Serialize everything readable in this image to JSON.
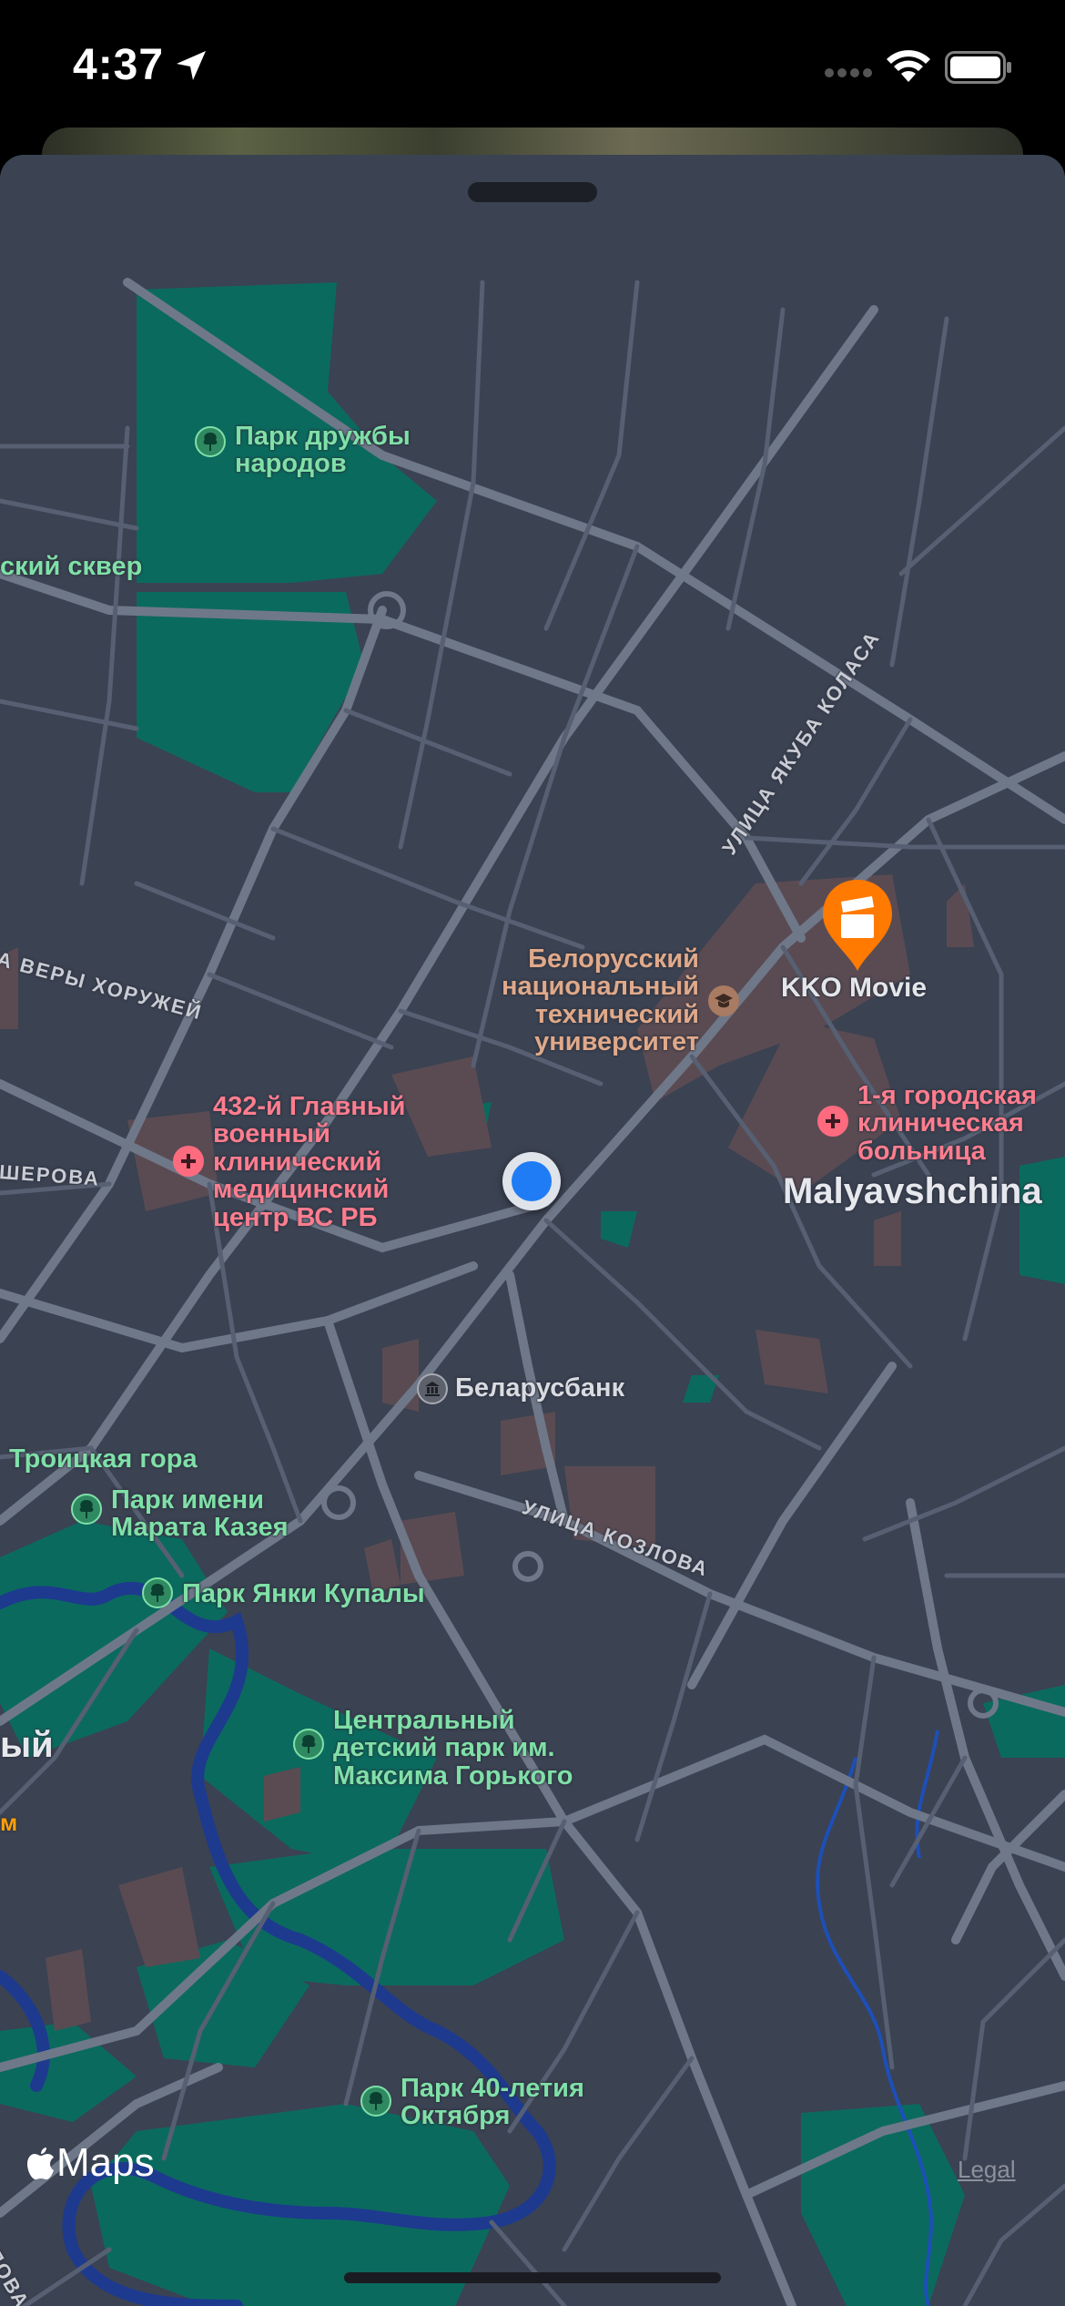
{
  "status_bar": {
    "time": "4:37",
    "icons": [
      "location-arrow-icon",
      "cellular-signal-icon",
      "wifi-icon",
      "battery-icon"
    ]
  },
  "map": {
    "colors": {
      "background": "#3b4252",
      "road": "#6f7889",
      "park": "#0b6a5e",
      "water": "#1d3a8f",
      "building": "#5a4b53"
    },
    "parks": [
      {
        "lines": [
          "Парк дружбы",
          "народов"
        ]
      },
      {
        "lines": [
          "ский сквер"
        ]
      },
      {
        "lines": [
          "Троицкая гора"
        ]
      },
      {
        "lines": [
          "Парк имени",
          "Марата Казея"
        ]
      },
      {
        "lines": [
          "Парк Янки Купалы"
        ]
      },
      {
        "lines": [
          "Центральный",
          "детский парк им.",
          "Максима Горького"
        ]
      },
      {
        "lines": [
          "Парк 40-летия",
          "Октября"
        ]
      }
    ],
    "university": {
      "lines": [
        "Белорусский",
        "национальный",
        "технический",
        "университет"
      ]
    },
    "medical": [
      {
        "lines": [
          "432-й Главный",
          "военный",
          "клинический",
          "медицинский",
          "центр ВС РБ"
        ]
      },
      {
        "lines": [
          "1-я городская",
          "клиническая",
          "больница"
        ]
      }
    ],
    "bank": "Беларусбанк",
    "cinema": "KKO Movie",
    "district": "Malyavshchina",
    "partial_district": "ый",
    "partial_label_orange": "м",
    "streets": [
      "УЛИЦА ЯКУБА КОЛАСА",
      "А ВЕРЫ ХОРУЖЕЙ",
      "ШЕРОВА",
      "УЛИЦА КОЗЛОВА",
      "ЛОВА"
    ]
  },
  "footer": {
    "brand": "Maps",
    "legal": "Legal"
  }
}
